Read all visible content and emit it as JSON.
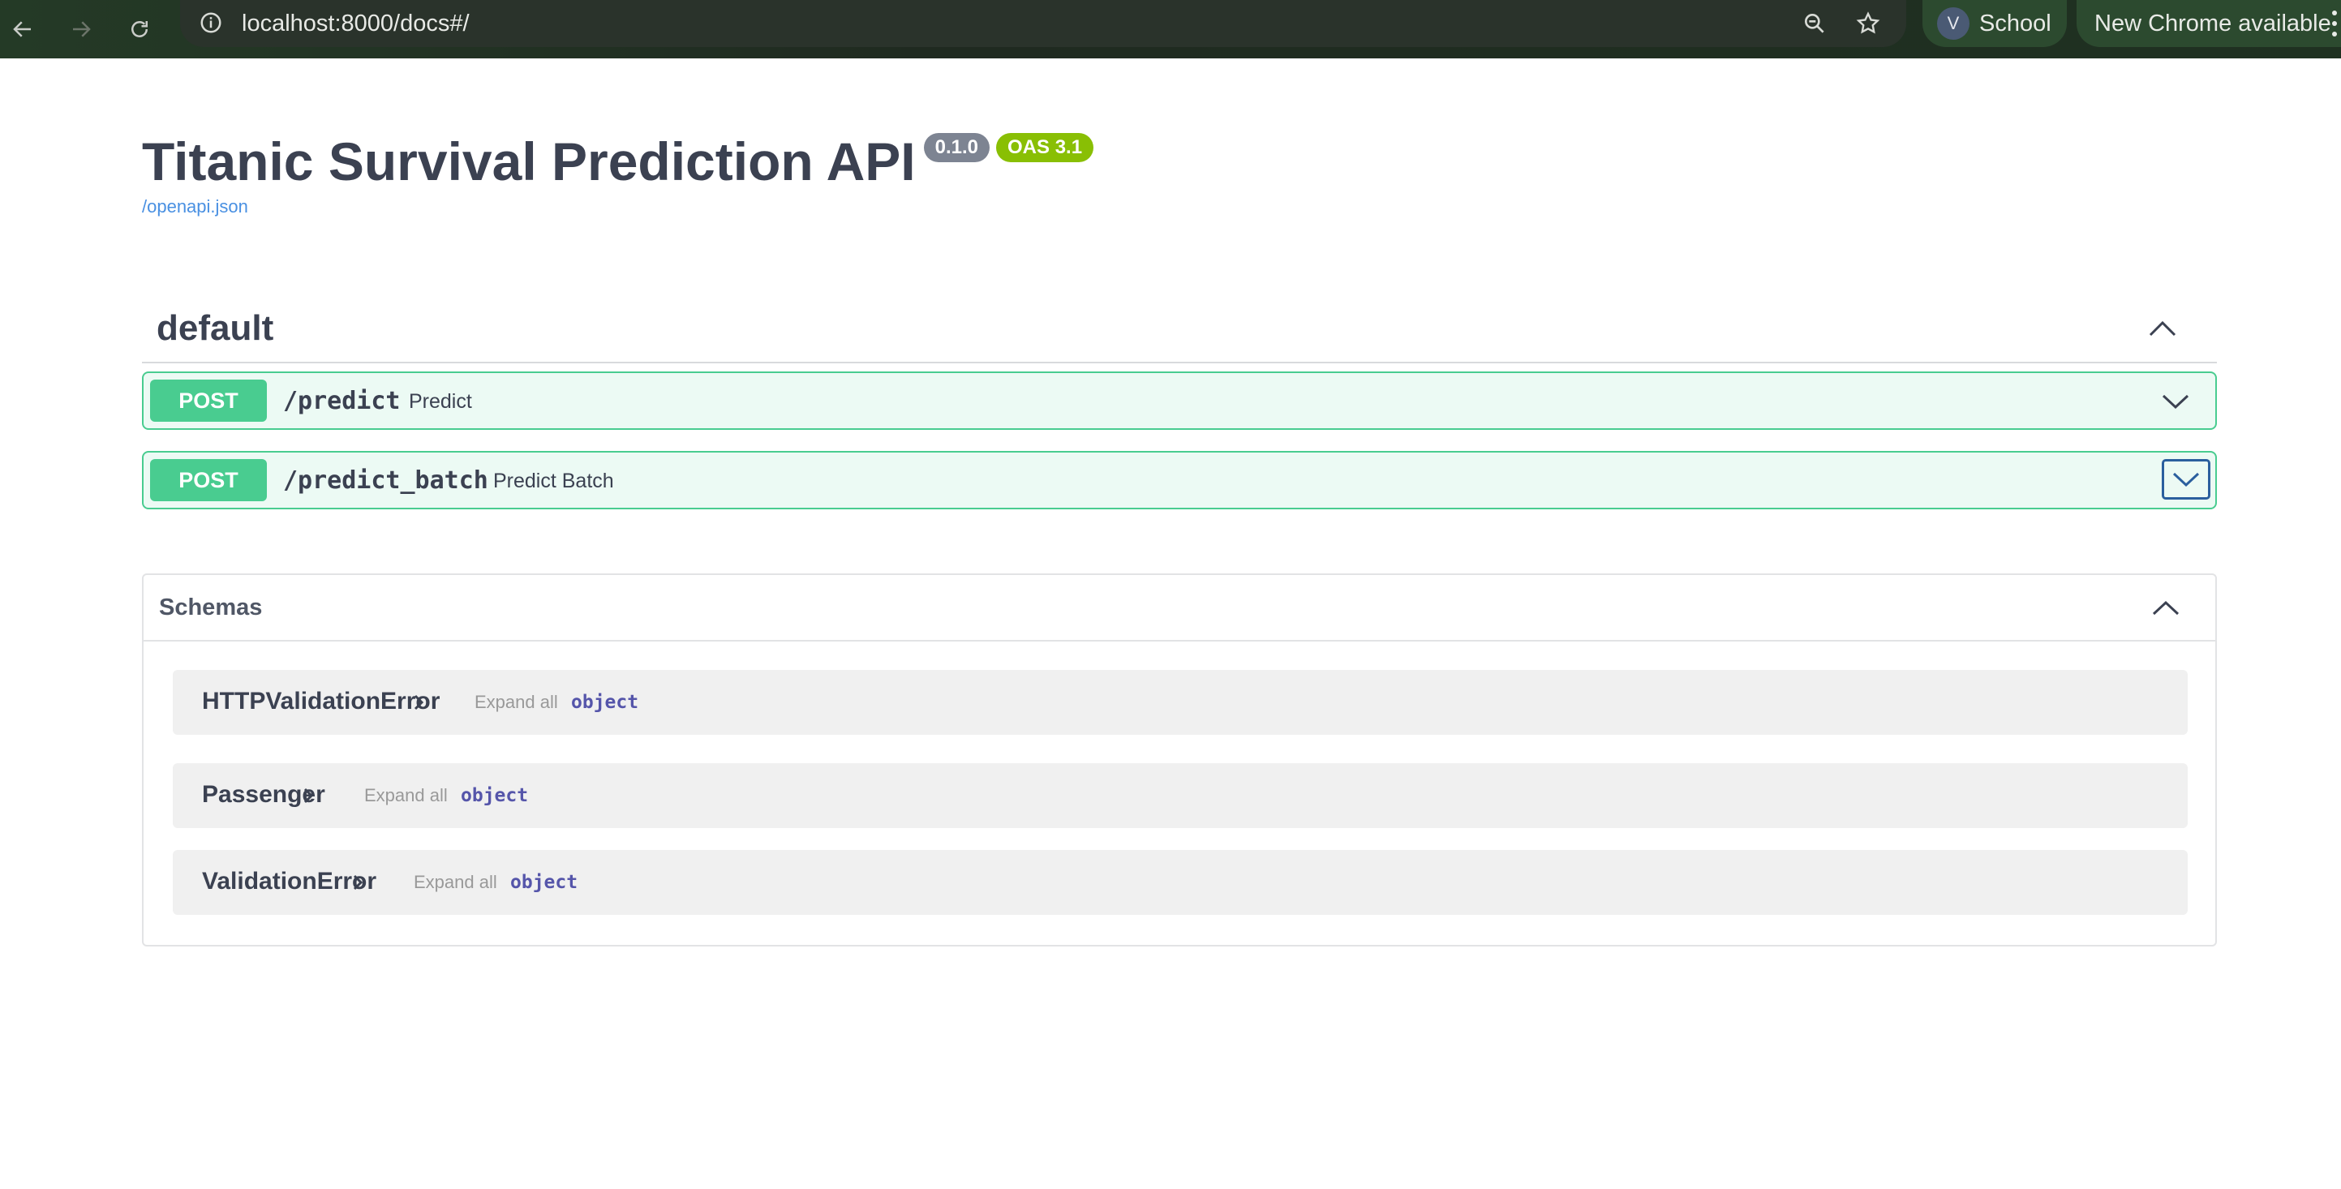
{
  "browser": {
    "url": "localhost:8000/docs#/",
    "profile_initial": "V",
    "profile_name": "School",
    "update_label": "New Chrome available"
  },
  "info": {
    "title": "Titanic Survival Prediction API",
    "version": "0.1.0",
    "oas_version": "OAS 3.1",
    "spec_link": "/openapi.json"
  },
  "tag": {
    "name": "default"
  },
  "operations": [
    {
      "method": "POST",
      "path": "/predict",
      "summary": "Predict"
    },
    {
      "method": "POST",
      "path": "/predict_batch",
      "summary": "Predict Batch"
    }
  ],
  "schemas": {
    "title": "Schemas",
    "models": [
      {
        "name": "HTTPValidationError",
        "expand_label": "Expand all",
        "type": "object"
      },
      {
        "name": "Passenger",
        "expand_label": "Expand all",
        "type": "object"
      },
      {
        "name": "ValidationError",
        "expand_label": "Expand all",
        "type": "object"
      }
    ]
  },
  "colors": {
    "post_method": "#49cc90",
    "link": "#4990e2",
    "version_badge": "#7d8492",
    "oas_badge": "#89bf04"
  }
}
